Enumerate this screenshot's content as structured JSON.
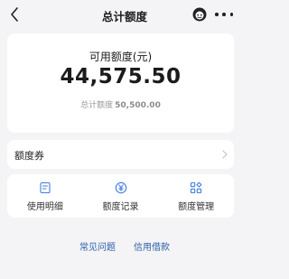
{
  "header": {
    "title": "总计额度",
    "back_icon": "chevron-left-icon",
    "support_icon": "customer-service-icon",
    "more_icon": "more-dots-icon"
  },
  "amount": {
    "label": "可用额度(元)",
    "value": "44,575.50",
    "total_label": "总计额度",
    "total_value": "50,500.00"
  },
  "coupon": {
    "label": "额度券",
    "arrow_icon": "chevron-right-icon"
  },
  "actions": [
    {
      "label": "使用明细",
      "icon": "document-list-icon"
    },
    {
      "label": "额度记录",
      "icon": "yen-coin-icon"
    },
    {
      "label": "额度管理",
      "icon": "grid-manage-icon"
    }
  ],
  "links": [
    {
      "label": "常见问题"
    },
    {
      "label": "信用借款"
    }
  ],
  "colors": {
    "background": "#f4f4f6",
    "accent": "#3f7de0",
    "link": "#2d5fa8"
  }
}
